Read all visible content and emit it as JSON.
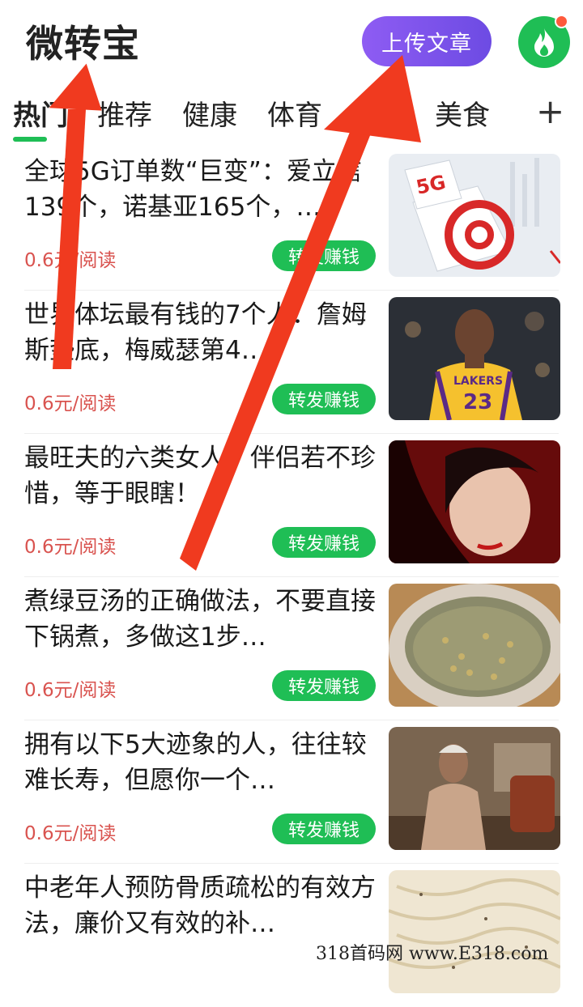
{
  "header": {
    "title": "微转宝",
    "upload_label": "上传文章",
    "fire_icon": "fire-icon",
    "accent": "#1fbe55",
    "upload_color": "#7b52eb"
  },
  "tabs": [
    {
      "label": "热门",
      "active": true
    },
    {
      "label": "推荐"
    },
    {
      "label": "健康"
    },
    {
      "label": "体育"
    },
    {
      "label": "美食"
    }
  ],
  "add_tab": "+",
  "feed": [
    {
      "title": "全球5G订单数“巨变”：爱立信139个，诺基亚165个，…",
      "price": "0.6元/阅读",
      "share": "转发赚钱"
    },
    {
      "title": "世界体坛最有钱的7个人：詹姆斯垫底，梅威瑟第4…",
      "price": "0.6元/阅读",
      "share": "转发赚钱"
    },
    {
      "title": "最旺夫的六类女人，伴侣若不珍惜，等于眼瞎！",
      "price": "0.6元/阅读",
      "share": "转发赚钱"
    },
    {
      "title": "煮绿豆汤的正确做法，不要直接下锅煮，多做这1步…",
      "price": "0.6元/阅读",
      "share": "转发赚钱"
    },
    {
      "title": "拥有以下5大迹象的人，往往较难长寿，但愿你一个…",
      "price": "0.6元/阅读",
      "share": "转发赚钱"
    },
    {
      "title": "中老年人预防骨质疏松的有效方法，廉价又有效的补…",
      "price": "",
      "share": ""
    }
  ],
  "watermark": "318首码网 www.E318.com",
  "thumb_labels": {
    "five_g": "5G",
    "jersey_team": "LAKERS",
    "jersey_number": "23"
  }
}
